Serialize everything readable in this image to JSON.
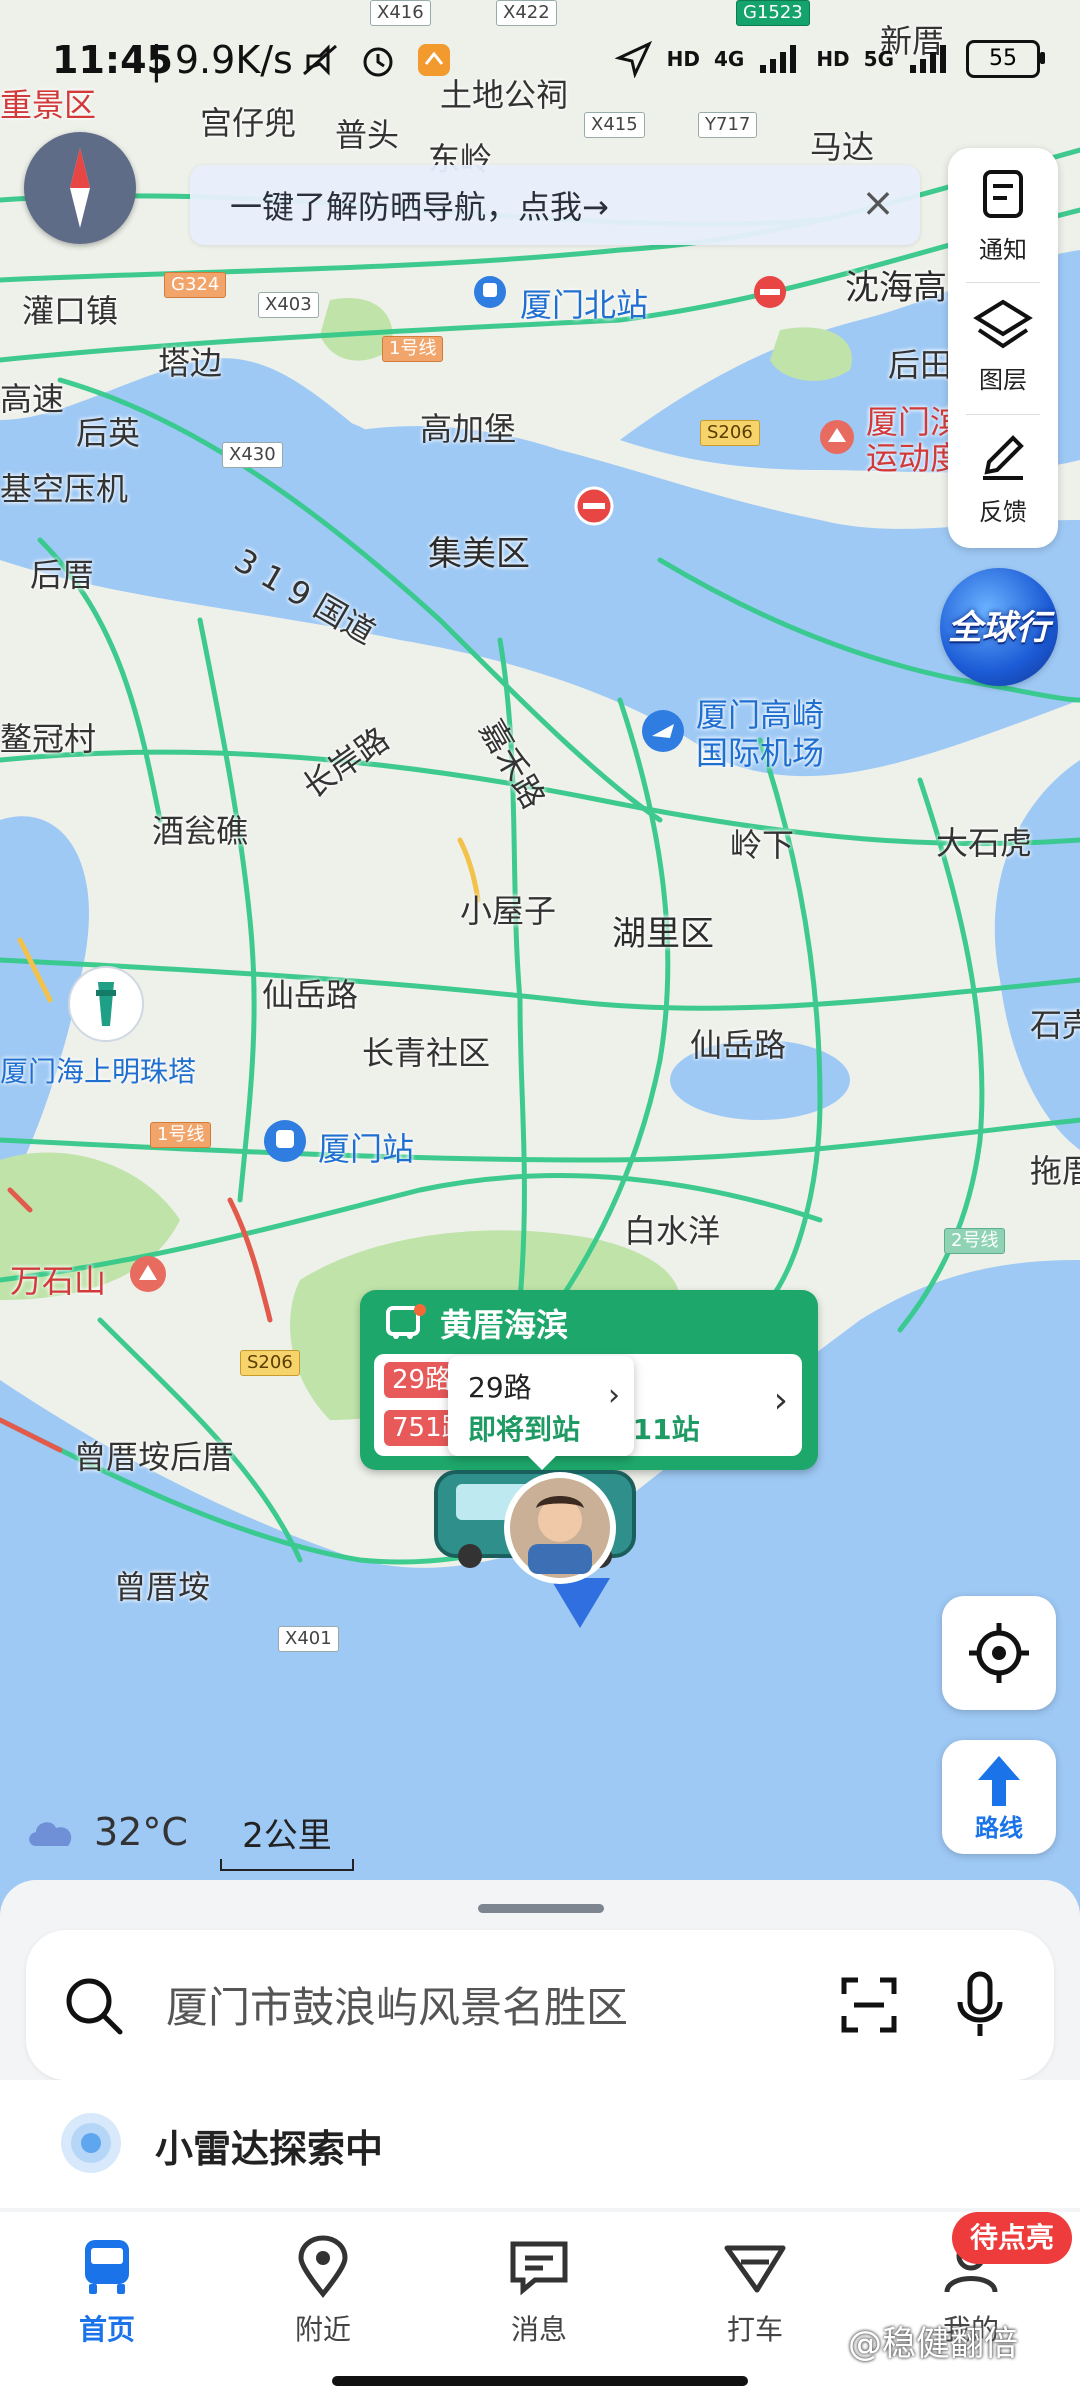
{
  "status_bar": {
    "time": "11:45",
    "network_speed": "| 9.9K/s",
    "net1": "4G",
    "net2": "5G",
    "battery": "55"
  },
  "compass": {
    "icon": "compass-icon"
  },
  "banner": {
    "text": "一键了解防晒导航，点我→"
  },
  "right_toolbar": {
    "notify": "通知",
    "layers": "图层",
    "feedback": "反馈"
  },
  "global_travel": "全球行",
  "map_labels": {
    "scenic": "重景区",
    "gongzibiao": "宫仔兜",
    "tudigongci": "土地公祠",
    "pushou": "普头",
    "dongling": "东岭",
    "mada": "马达",
    "xinlin": "新厝",
    "guankou": "灌口镇",
    "tabian": "塔边",
    "tabian2": "塔边",
    "xiamen_north": "厦门北站",
    "gaojiabao": "高加堡",
    "jimei": "集美区",
    "shenhai": "沈海高",
    "houtian": "后田",
    "houying": "后英",
    "jikong": "基空压机",
    "houcuo": "后厝",
    "gaosu": "高速",
    "guodao": "3 1 9 国道",
    "shuzhuan": "厦门滨 运动度",
    "aoguancun": "鳌冠村",
    "airport": "厦门高崎 国际机场",
    "jiuwenjie": "酒瓮礁",
    "changanlu": "长岸路",
    "jiahelu": "嘉禾路",
    "lingxia": "岭下",
    "dashihu": "大石虎",
    "xiaowuzi": "小屋子",
    "huli": "湖里区",
    "xianyue1": "仙岳路",
    "xianyue2": "仙岳路",
    "mingzhuta": "厦门海上明珠塔",
    "changqing": "长青社区",
    "xiamen_station": "厦门站",
    "baishuiyang": "白水洋",
    "shishan": "石壳",
    "tuodong": "拖厝",
    "wanshishan": "万石山",
    "zengcuoan_houcuo": "曾厝垵后厝",
    "zengcuoan": "曾厝垵"
  },
  "road_tags": {
    "x416": "X416",
    "x422": "X422",
    "g1523": "G1523",
    "x415": "X415",
    "y717": "Y717",
    "g324": "G324",
    "x403": "X403",
    "line1a": "1号线",
    "s206a": "S206",
    "x430": "X430",
    "line1b": "1号线",
    "line2": "2号线",
    "s206b": "S206",
    "x401": "X401"
  },
  "bus_card": {
    "station": "黄厝海滨",
    "route1": "29路",
    "route2": "751路",
    "eta": "时·11站",
    "popup_route": "29路",
    "popup_status": "即将到站"
  },
  "weather": {
    "temp": "32°C",
    "icon": "cloud-icon"
  },
  "scale": "2公里",
  "route_button": "路线",
  "search": {
    "placeholder": "厦门市鼓浪屿风景名胜区"
  },
  "radar": {
    "text": "小雷达探索中"
  },
  "tabs": [
    {
      "label": "首页",
      "icon": "bus-icon",
      "active": true
    },
    {
      "label": "附近",
      "icon": "location-pin-icon"
    },
    {
      "label": "消息",
      "icon": "message-icon"
    },
    {
      "label": "打车",
      "icon": "taxi-icon"
    },
    {
      "label": "我的",
      "icon": "profile-icon"
    }
  ],
  "badge": "待点亮",
  "watermark": "@稳健翻倍",
  "colors": {
    "accent": "#1a73e8",
    "bus_green": "#1ea76b",
    "route_red": "#e85a5a",
    "badge_red": "#ee3b3b",
    "water": "#9ec9f5"
  }
}
